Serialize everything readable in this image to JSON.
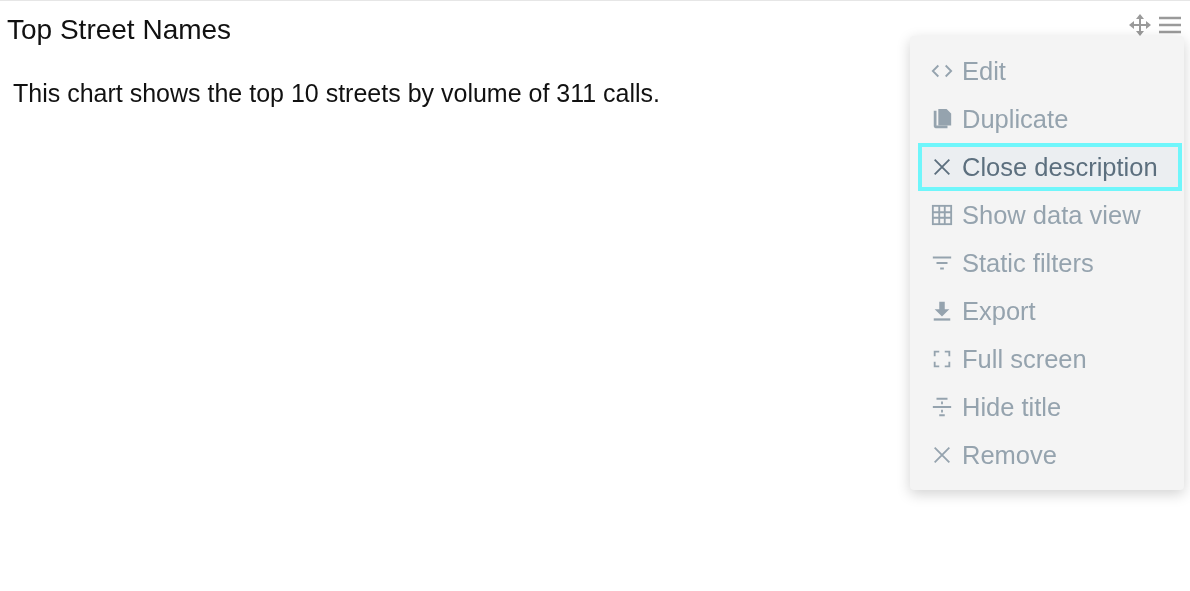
{
  "panel": {
    "title": "Top Street Names",
    "description": "This chart shows the top 10 streets by volume of 311 calls."
  },
  "menu": {
    "items": [
      {
        "label": "Edit",
        "kind": "code",
        "selected": false
      },
      {
        "label": "Duplicate",
        "kind": "duplicate",
        "selected": false
      },
      {
        "label": "Close description",
        "kind": "close",
        "selected": true
      },
      {
        "label": "Show data view",
        "kind": "table",
        "selected": false
      },
      {
        "label": "Static filters",
        "kind": "filter",
        "selected": false
      },
      {
        "label": "Export",
        "kind": "download",
        "selected": false
      },
      {
        "label": "Full screen",
        "kind": "fullscreen",
        "selected": false
      },
      {
        "label": "Hide title",
        "kind": "hide-title",
        "selected": false
      },
      {
        "label": "Remove",
        "kind": "close",
        "selected": false
      }
    ]
  }
}
